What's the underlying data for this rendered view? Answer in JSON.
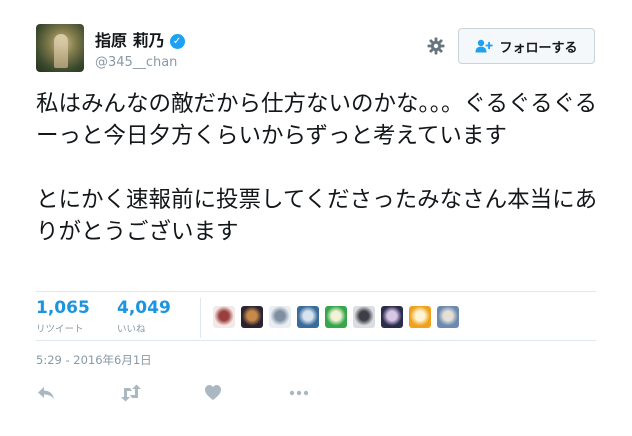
{
  "user": {
    "name": "指原 莉乃",
    "handle": "@345__chan",
    "verified_mark": "✓"
  },
  "follow_button": {
    "label": "フォローする"
  },
  "tweet": {
    "text": "私はみんなの敵だから仕方ないのかな。。。ぐるぐるぐるーっと今日夕方くらいからずっと考えています\n\nとにかく速報前に投票してくださったみなさん本当にありがとうございます"
  },
  "stats": {
    "retweets": {
      "count": "1,065",
      "label": "リツイート"
    },
    "likes": {
      "count": "4,049",
      "label": "いいね"
    }
  },
  "liker_avatars": [
    {
      "name": "liker-avatar-1",
      "colors": [
        "#f3e9e6",
        "#9b3e3e"
      ]
    },
    {
      "name": "liker-avatar-2",
      "colors": [
        "#2b2430",
        "#c88a4a"
      ]
    },
    {
      "name": "liker-avatar-3",
      "colors": [
        "#e9eef3",
        "#7d8fa0"
      ]
    },
    {
      "name": "liker-avatar-4",
      "colors": [
        "#3b6b9a",
        "#d7e4ef"
      ]
    },
    {
      "name": "liker-avatar-5",
      "colors": [
        "#35a64a",
        "#f2f2d8"
      ]
    },
    {
      "name": "liker-avatar-6",
      "colors": [
        "#dadde2",
        "#3d3f46"
      ]
    },
    {
      "name": "liker-avatar-7",
      "colors": [
        "#2a2b4d",
        "#d8c6e6"
      ]
    },
    {
      "name": "liker-avatar-8",
      "colors": [
        "#f0a21e",
        "#fff4d6"
      ]
    },
    {
      "name": "liker-avatar-9",
      "colors": [
        "#6c8ab0",
        "#e4e0d6"
      ]
    }
  ],
  "timestamp": "5:29 - 2016年6月1日",
  "colors": {
    "accent": "#1b95e0",
    "muted": "#8899a6",
    "icon": "#aab8c2"
  }
}
